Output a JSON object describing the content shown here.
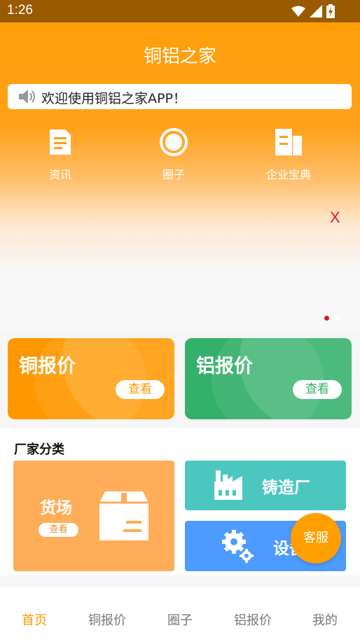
{
  "status": {
    "time": "1:26"
  },
  "header": {
    "title": "铜铝之家"
  },
  "notice": {
    "text": "欢迎使用铜铝之家APP！"
  },
  "quick_links": [
    {
      "label": "资讯",
      "icon": "news-doc-icon"
    },
    {
      "label": "圈子",
      "icon": "circle-icon"
    },
    {
      "label": "企业宝典",
      "icon": "building-icon"
    }
  ],
  "banner": {
    "close_label": "X"
  },
  "prices": {
    "copper": {
      "label": "铜报价",
      "button": "查看",
      "color": "#ff9800"
    },
    "aluminum": {
      "label": "铝报价",
      "button": "查看",
      "color": "#33b06a"
    }
  },
  "factory_section": {
    "heading": "厂家分类",
    "yard": {
      "label": "货场",
      "button": "查看"
    },
    "foundry": {
      "label": "铸造厂"
    },
    "equipment": {
      "label": "设备"
    }
  },
  "service": {
    "label": "客服"
  },
  "tabs": [
    {
      "label": "首页",
      "active": true
    },
    {
      "label": "铜报价",
      "active": false
    },
    {
      "label": "圈子",
      "active": false
    },
    {
      "label": "铝报价",
      "active": false
    },
    {
      "label": "我的",
      "active": false
    }
  ],
  "colors": {
    "accent": "#ff9800",
    "teal": "#4cc7c0",
    "blue": "#4e9bff",
    "yard": "#ffad58"
  }
}
